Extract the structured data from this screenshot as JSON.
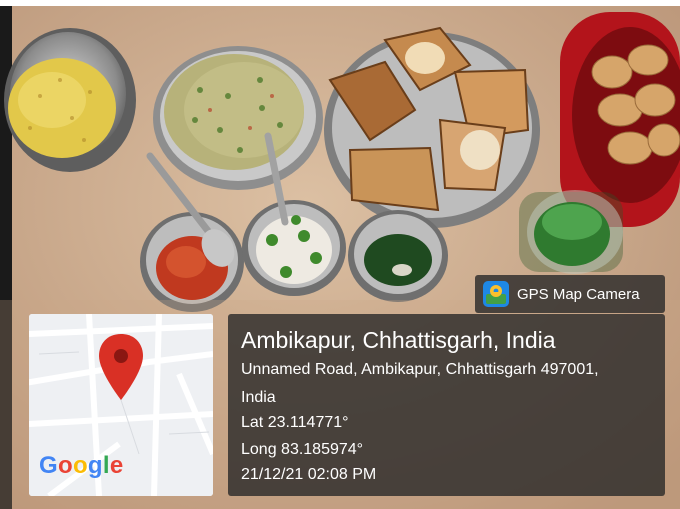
{
  "overlay": {
    "badge": {
      "icon": "gps-map-camera-icon",
      "label": "GPS Map Camera"
    },
    "map_thumbnail": {
      "logo_text_letters": [
        "G",
        "o",
        "o",
        "g",
        "l",
        "e"
      ],
      "logo_colors": [
        "#4285F4",
        "#EA4335",
        "#FBBC05",
        "#4285F4",
        "#34A853",
        "#EA4335"
      ],
      "pin_color": "#D93025"
    },
    "location": {
      "title": "Ambikapur, Chhattisgarh, India",
      "address_line_1": "Unnamed Road, Ambikapur, Chhattisgarh 497001,",
      "address_line_2": "India",
      "latitude": "Lat 23.114771°",
      "longitude": "Long 83.185974°",
      "datetime": "21/12/21 02:08 PM"
    }
  },
  "colors": {
    "panel_background": "rgba(40,40,40,0.80)",
    "panel_text": "#ffffff",
    "table_background": "#d8b99a"
  }
}
